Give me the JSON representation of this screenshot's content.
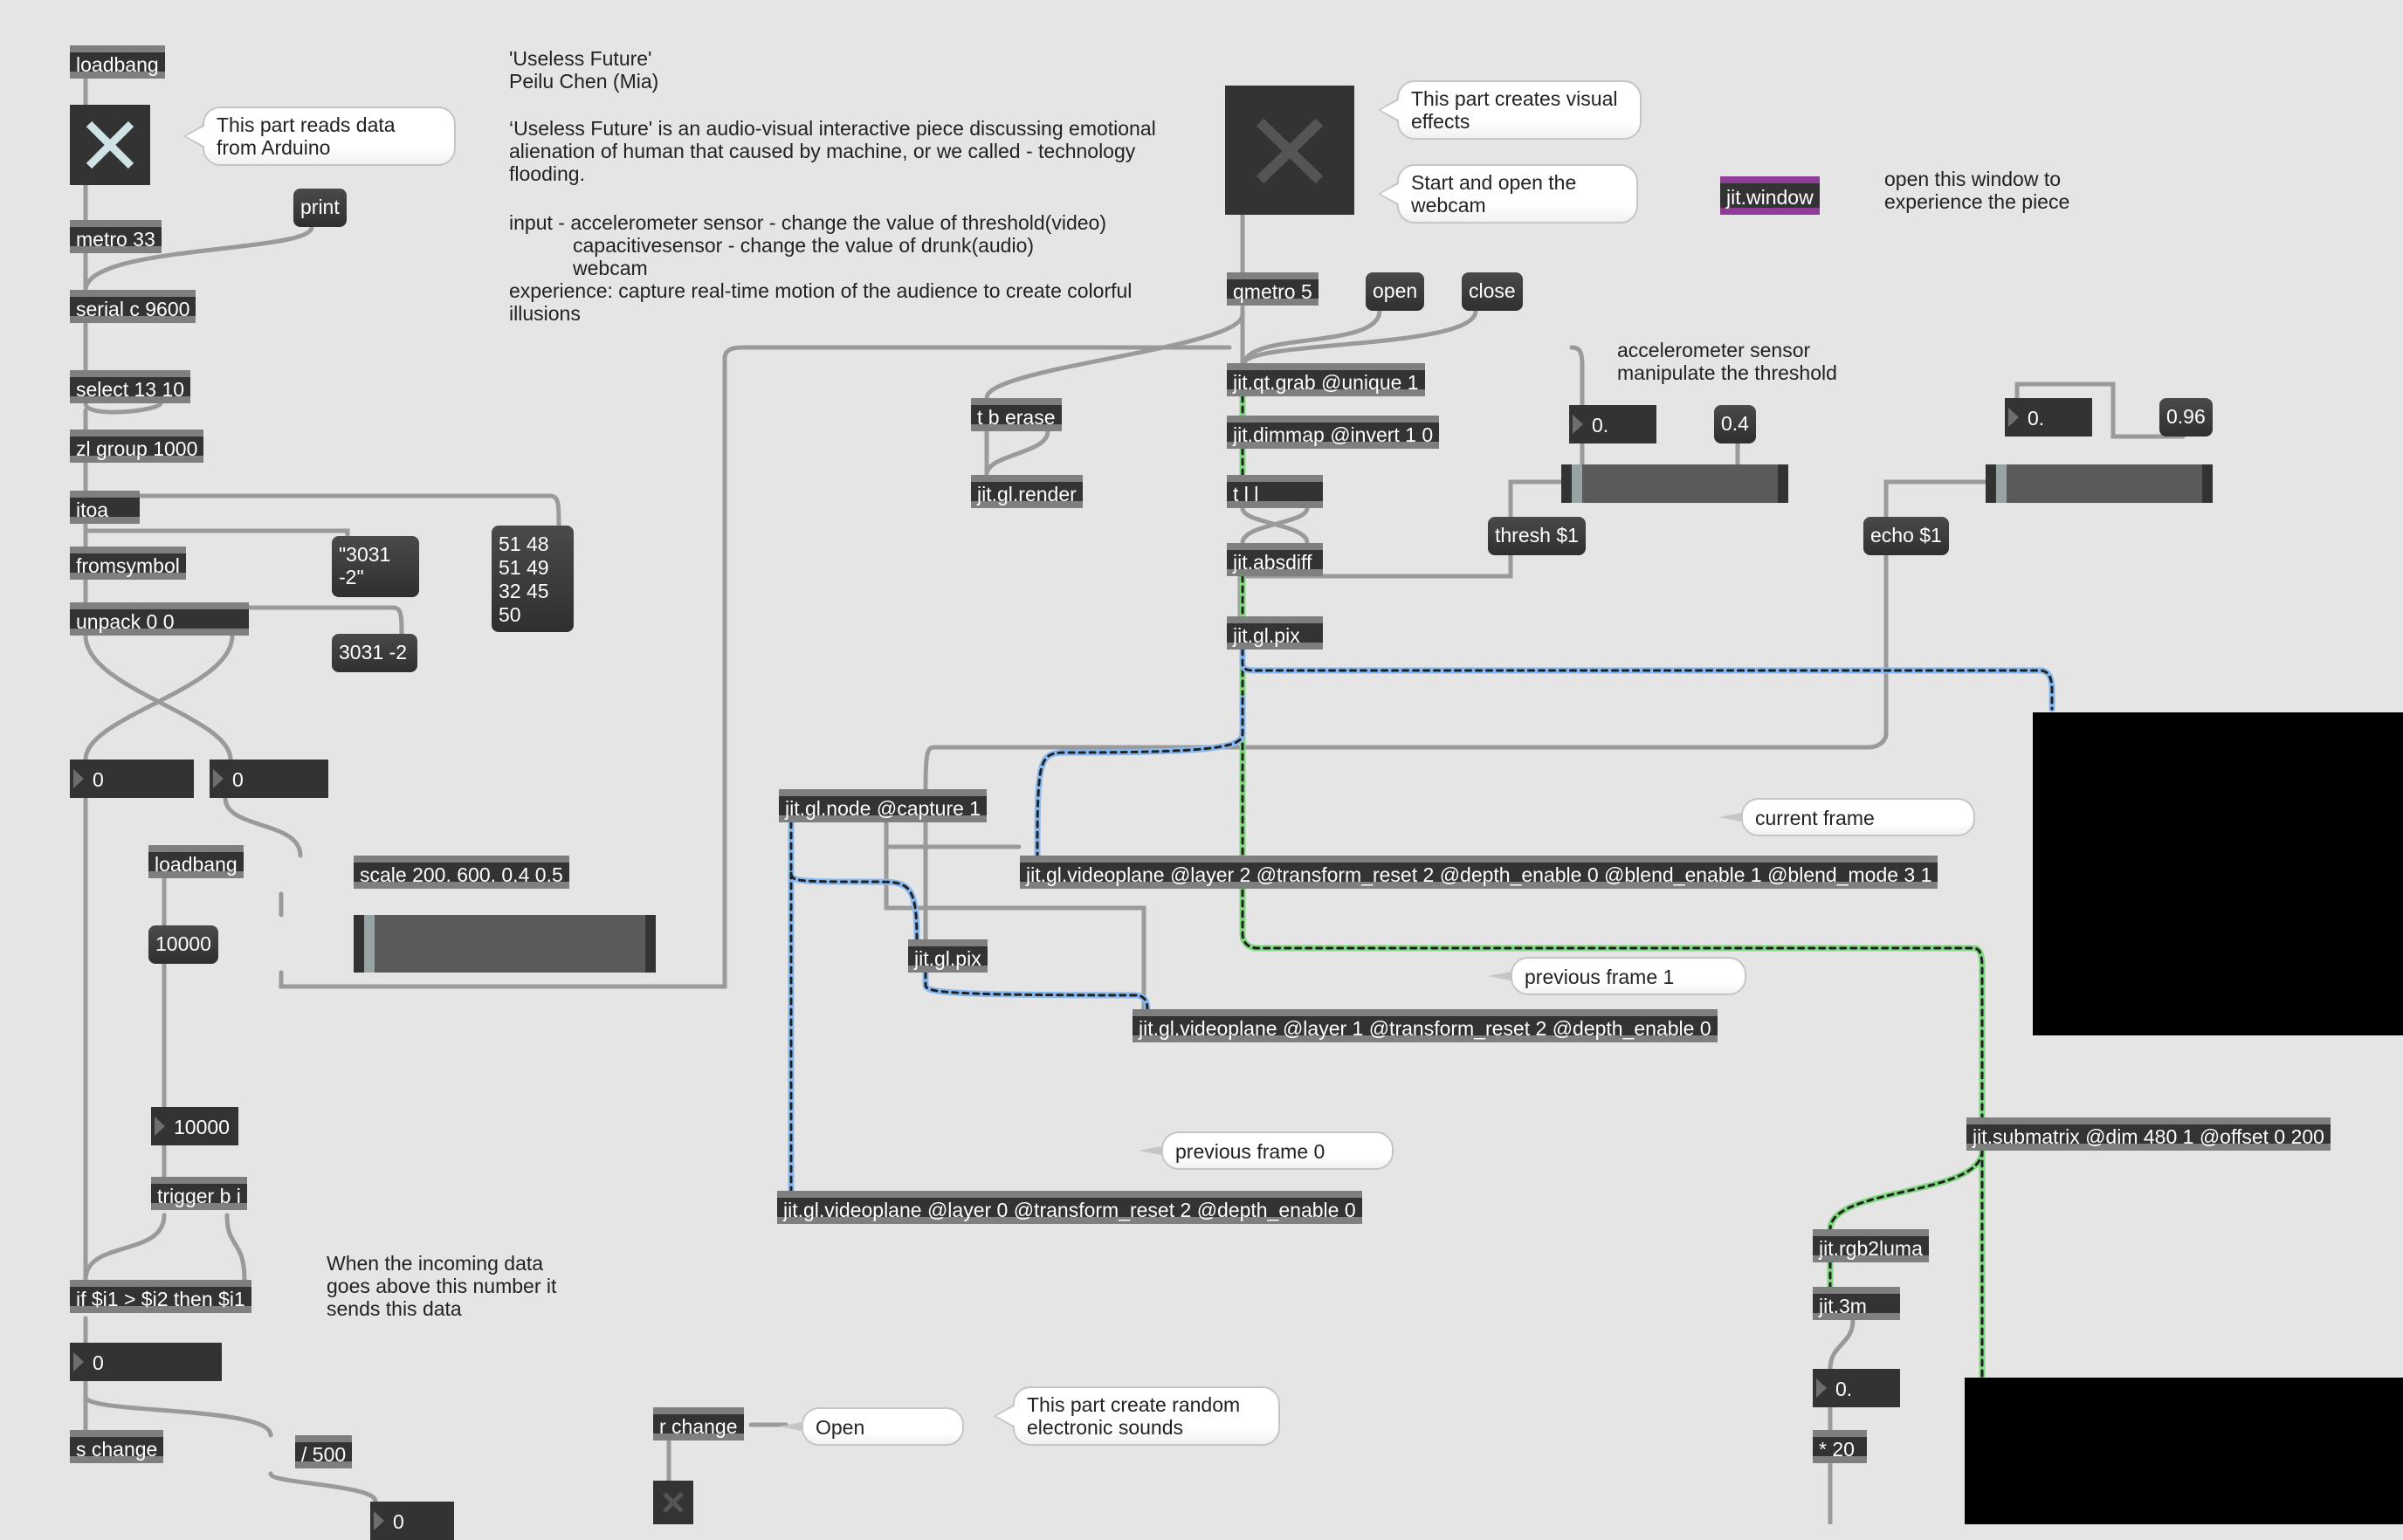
{
  "patcher": {
    "arduino_section": {
      "loadbang": "loadbang",
      "toggle_on": true,
      "bubble": "This part reads data\nfrom Arduino",
      "print_msg": "print",
      "metro": "metro 33",
      "serial": "serial c 9600",
      "select": "select 13 10",
      "zl_group": "zl group 1000",
      "itoa": "itoa",
      "fromsymbol": "fromsymbol",
      "unpack": "unpack 0 0",
      "msg_symbol": "\"3031\n-2\"",
      "msg_bytes": "51 48\n51 49\n32 45\n50",
      "msg_list": "3031 -2",
      "number_left": "0",
      "number_right": "0",
      "loadbang2": "loadbang",
      "msg_10000": "10000",
      "number_10000": "10000",
      "trigger": "trigger b i",
      "if_expr": "if $i1 > $i2 then $i1",
      "threshold_comment": "When the incoming data\ngoes above this number it\nsends this data",
      "number_if_out": "0",
      "send_change": "s change",
      "divide": "/ 500",
      "number_div_out": "0",
      "scale": "scale 200. 600. 0.4 0.5",
      "scale_slider_value": 0.0
    },
    "description": {
      "title": "'Useless Future'",
      "author": "Peilu Chen (Mia)",
      "body": "‘Useless Future' is an audio-visual interactive piece discussing emotional\nalienation of human that caused by machine, or we called - technology\nflooding.",
      "input_line1": "input - accelerometer sensor - change the value of threshold(video)",
      "input_line2": "capacitivesensor - change the value of drunk(audio)",
      "input_line3": "webcam",
      "experience": "experience: capture real-time motion of the audience to create colorful\nillusions"
    },
    "visual_section": {
      "toggle_on": false,
      "bubble_visual": "This part creates visual\neffects",
      "bubble_webcam": "Start and open the\nwebcam",
      "jit_window": "jit.window",
      "window_comment": "open this window to\nexperience the piece",
      "qmetro": "qmetro 5",
      "open_msg": "open",
      "close_msg": "close",
      "t_b_erase": "t b erase",
      "gl_render": "jit.gl.render",
      "qt_grab": "jit.qt.grab @unique 1",
      "dimmap": "jit.dimmap @invert 1 0",
      "t_l_l": "t l l",
      "absdiff": "jit.absdiff",
      "gl_pix": "jit.gl.pix",
      "accel_comment": "accelerometer sensor\nmanipulate the threshold",
      "thresh_number": "0.",
      "thresh_preset": "0.4",
      "thresh_slider_value": 0.0,
      "thresh_msg": "thresh $1",
      "echo_number": "0.",
      "echo_preset": "0.96",
      "echo_slider_value": 0.0,
      "echo_msg": "echo $1",
      "gl_node": "jit.gl.node @capture 1",
      "videoplane_2": "jit.gl.videoplane @layer 2 @transform_reset 2 @depth_enable 0 @blend_enable 1 @blend_mode 3 1",
      "bubble_current": "current frame",
      "gl_pix2": "jit.gl.pix",
      "videoplane_1": "jit.gl.videoplane @layer 1 @transform_reset 2 @depth_enable 0",
      "bubble_prev1": "previous frame 1",
      "bubble_prev0": "previous frame 0",
      "videoplane_0": "jit.gl.videoplane @layer 0 @transform_reset 2 @depth_enable 0",
      "submatrix": "jit.submatrix @dim 480 1 @offset 0 200",
      "rgb2luma": "jit.rgb2luma",
      "jit3m": "jit.3m",
      "luma_number": "0.",
      "mult": "* 20"
    },
    "audio_section": {
      "receive_change": "r change",
      "open_bubble": "Open",
      "bubble_sounds": "This part create random\nelectronic sounds",
      "toggle_on": false
    }
  },
  "colors": {
    "background": "#e5e5e5",
    "object_fill": "#333333",
    "object_border": "#7f7f7f",
    "jit_window_border": "#8e3c98",
    "matrix_cable": "#7fd77f",
    "gl_texture_cable": "#86b8ef",
    "toggle_active_x": "#cfe3e6"
  }
}
